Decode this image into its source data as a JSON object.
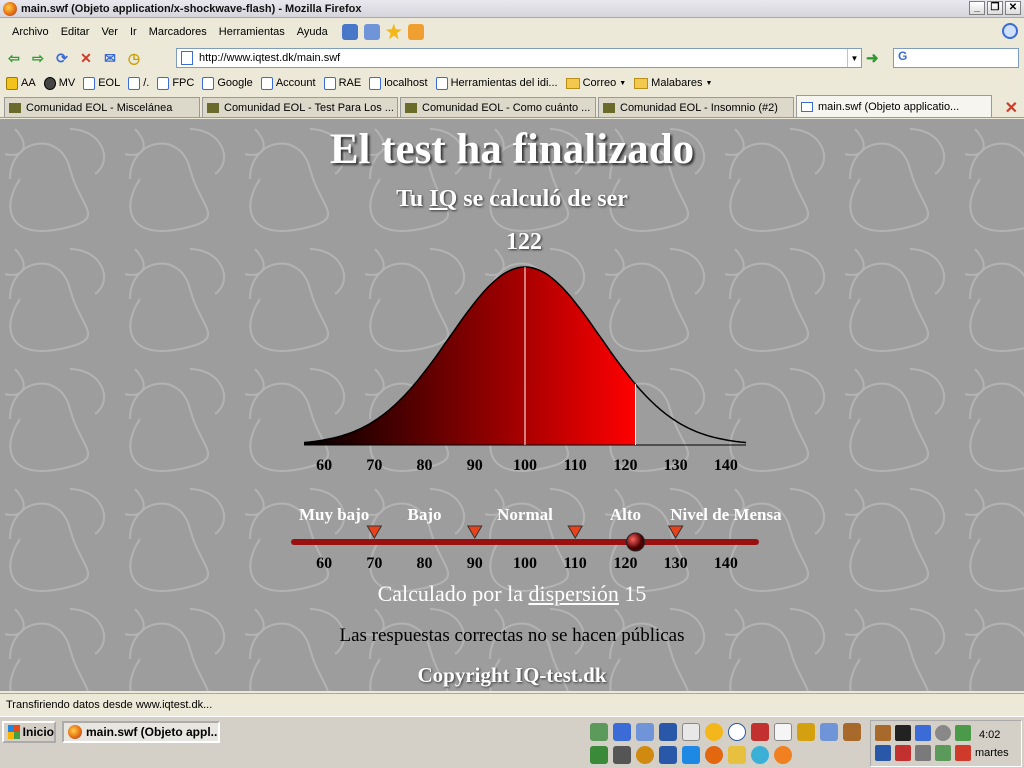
{
  "window": {
    "title": "main.swf (Objeto application/x-shockwave-flash) - Mozilla Firefox",
    "buttons": {
      "minimize": "_",
      "maximize": "❐",
      "close": "✕"
    }
  },
  "menubar": {
    "items": [
      "Archivo",
      "Editar",
      "Ver",
      "Ir",
      "Marcadores",
      "Herramientas",
      "Ayuda"
    ]
  },
  "navbar": {
    "url": "http://www.iqtest.dk/main.swf",
    "search_value": "G"
  },
  "bookmarks": [
    {
      "label": "AA",
      "icon": "s-icon"
    },
    {
      "label": "MV",
      "icon": "mv-icon"
    },
    {
      "label": "EOL",
      "icon": "page-icon"
    },
    {
      "label": "/.",
      "icon": "page-icon"
    },
    {
      "label": "FPC",
      "icon": "page-icon"
    },
    {
      "label": "Google",
      "icon": "page-icon"
    },
    {
      "label": "Account",
      "icon": "page-icon"
    },
    {
      "label": "RAE",
      "icon": "page-icon"
    },
    {
      "label": "localhost",
      "icon": "page-icon"
    },
    {
      "label": "Herramientas del idi...",
      "icon": "page-icon"
    },
    {
      "label": "Correo",
      "icon": "folder-icon"
    },
    {
      "label": "Malabares",
      "icon": "folder-icon"
    }
  ],
  "tabs": [
    {
      "label": "Comunidad EOL - Miscelánea",
      "active": false
    },
    {
      "label": "Comunidad EOL - Test Para Los ...",
      "active": false
    },
    {
      "label": "Comunidad EOL - Como cuánto ...",
      "active": false
    },
    {
      "label": "Comunidad EOL - Insomnio (#2)",
      "active": false
    },
    {
      "label": "main.swf (Objeto applicatio...",
      "active": true
    }
  ],
  "content": {
    "title": "El test ha finalizado",
    "subtitle_pre": "Tu",
    "subtitle_link": "IQ",
    "subtitle_post": "se calculó de ser",
    "score": "122",
    "dispersion_pre": "Calculado por la",
    "dispersion_link": "dispersión",
    "dispersion_value": "15",
    "answers_note": "Las respuestas correctas no se hacen públicas",
    "copyright": "Copyright IQ-test.dk"
  },
  "chart_data": {
    "type": "area",
    "distribution": "normal",
    "mean": 100,
    "sd": 15,
    "score": 122,
    "xlim": [
      56,
      144
    ],
    "x_ticks": [
      60,
      70,
      80,
      90,
      100,
      110,
      120,
      130,
      140
    ],
    "categories": [
      "Muy bajo",
      "Bajo",
      "Normal",
      "Alto",
      "Nivel de Mensa"
    ],
    "category_boundaries": [
      70,
      90,
      110,
      130
    ],
    "colors": {
      "fill_start": "#000000",
      "fill_end": "#ff0000",
      "curve": "#000000",
      "slider": "#9a1010",
      "marker": "#e8421a"
    }
  },
  "statusbar": {
    "text": "Transfiriendo datos desde www.iqtest.dk..."
  },
  "taskbar": {
    "start_label": "Inicio",
    "task_label": "main.swf (Objeto appl...",
    "clock": "4:02",
    "day": "martes"
  }
}
